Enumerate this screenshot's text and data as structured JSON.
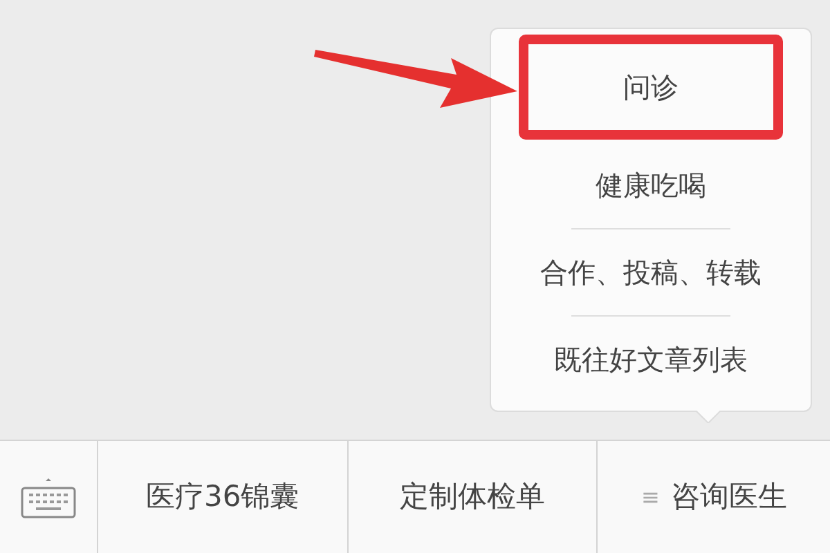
{
  "popup_menu": {
    "items": [
      {
        "label": "问诊",
        "highlighted": true
      },
      {
        "label": "健康吃喝",
        "highlighted": false
      },
      {
        "label": "合作、投稿、转载",
        "highlighted": false
      },
      {
        "label": "既往好文章列表",
        "highlighted": false
      }
    ]
  },
  "pointer_arrow": true,
  "bottom_menu": {
    "items": [
      {
        "label": "医疗36锦囊"
      },
      {
        "label": "定制体检单"
      },
      {
        "label": "咨询医生",
        "icon": "≡"
      }
    ]
  }
}
